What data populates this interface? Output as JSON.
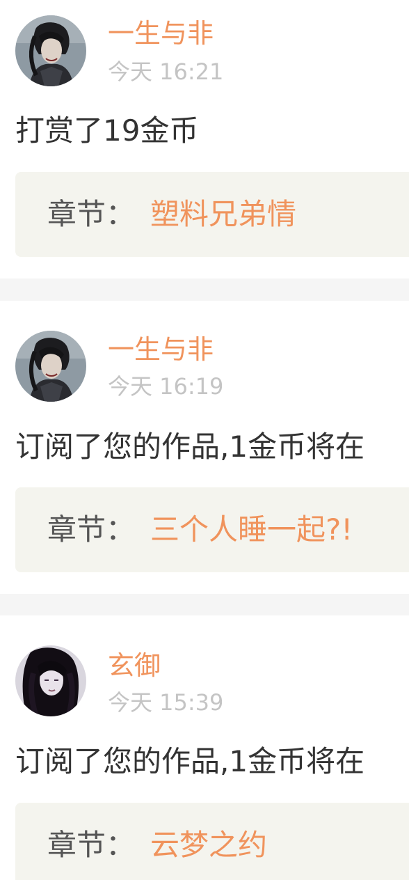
{
  "notifications": [
    {
      "username": "一生与非",
      "time": "今天 16:21",
      "message": "打赏了19金币",
      "chapter_label": "章节：",
      "chapter_title": "塑料兄弟情",
      "avatar": "male-character-avatar"
    },
    {
      "username": "一生与非",
      "time": "今天 16:19",
      "message": "订阅了您的作品,1金币将在",
      "chapter_label": "章节：",
      "chapter_title": "三个人睡一起?!",
      "avatar": "male-character-avatar"
    },
    {
      "username": "玄御",
      "time": "今天 15:39",
      "message": "订阅了您的作品,1金币将在",
      "chapter_label": "章节：",
      "chapter_title": "云梦之约",
      "avatar": "anime-girl-avatar"
    }
  ],
  "colors": {
    "accent": "#f0935c",
    "time": "#c4c4c4",
    "text": "#333333",
    "chapter_bg": "#f4f4ee",
    "separator": "#f5f5f5"
  }
}
